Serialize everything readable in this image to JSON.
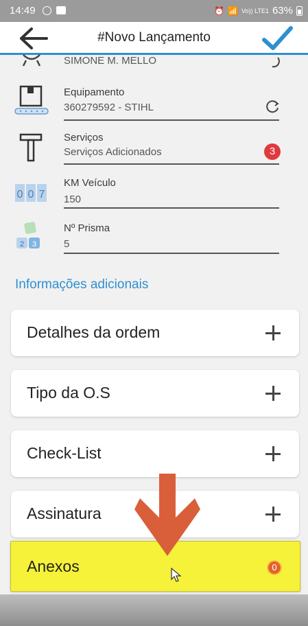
{
  "status_bar": {
    "time": "14:49",
    "network": "Vo)) LTE1",
    "battery": "63%"
  },
  "header": {
    "title": "#Novo Lançamento",
    "back_icon": "arrow-left-icon",
    "confirm_icon": "checkmark-icon"
  },
  "fields": [
    {
      "label": "",
      "value": "SIMONE M. MELLO",
      "icon": "user-icon"
    },
    {
      "label": "Equipamento",
      "value": "360279592 - STIHL",
      "icon": "equipment-box-icon"
    },
    {
      "label": "Serviços",
      "value": "Serviços Adicionados",
      "badge": "3",
      "icon": "hammer-icon"
    },
    {
      "label": "KM Veículo",
      "value": "150",
      "icon": "odometer-icon"
    },
    {
      "label": "Nº Prisma",
      "value": "5",
      "icon": "prism-blocks-icon"
    }
  ],
  "section_title": "Informações adicionais",
  "cards": [
    {
      "label": "Detalhes da ordem"
    },
    {
      "label": "Tipo da O.S"
    },
    {
      "label": "Check-List"
    },
    {
      "label": "Assinatura"
    },
    {
      "label": "Anexos",
      "badge": "0",
      "highlighted": true
    }
  ],
  "colors": {
    "accent": "#2f8fd0",
    "highlight": "#f6f23a",
    "arrow": "#d95f3b",
    "badge_red": "#e0393e"
  }
}
